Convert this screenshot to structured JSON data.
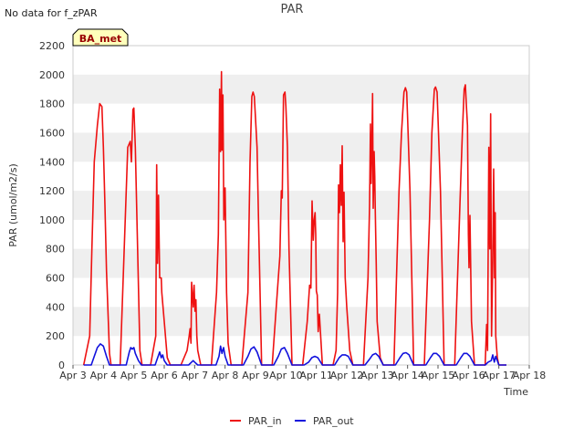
{
  "header": {
    "no_data_text": "No data for f_zPAR",
    "title": "PAR"
  },
  "site_badge": "BA_met",
  "colors": {
    "PAR_in": "#ee1111",
    "PAR_out": "#1111dd",
    "band": "#efefef",
    "badge_fill": "#ffffbb",
    "badge_text": "#990000"
  },
  "chart_data": {
    "type": "line",
    "title": "PAR",
    "xlabel": "Time",
    "ylabel": "PAR (umol/m2/s)",
    "ylim": [
      0,
      2200
    ],
    "xlim": [
      3,
      18
    ],
    "yticks": [
      0,
      200,
      400,
      600,
      800,
      1000,
      1200,
      1400,
      1600,
      1800,
      2000,
      2200
    ],
    "xticks": [
      3,
      4,
      5,
      6,
      7,
      8,
      9,
      10,
      11,
      12,
      13,
      14,
      15,
      16,
      17,
      18
    ],
    "xtick_labels": [
      "Apr 3",
      "Apr 4",
      "Apr 5",
      "Apr 6",
      "Apr 7",
      "Apr 8",
      "Apr 9",
      "Apr 10",
      "Apr 11",
      "Apr 12",
      "Apr 13",
      "Apr 14",
      "Apr 15",
      "Apr 16",
      "Apr 17",
      "Apr 18"
    ],
    "x_unit": "day of April",
    "grid": "horizontal bands",
    "legend_position": "bottom",
    "series": [
      {
        "name": "PAR_in",
        "x": [
          3.35,
          3.55,
          3.62,
          3.7,
          3.8,
          3.88,
          3.95,
          4.0,
          4.05,
          4.1,
          4.2,
          4.25,
          4.55,
          4.8,
          4.88,
          4.92,
          4.97,
          5.0,
          5.05,
          5.2,
          5.27,
          5.55,
          5.72,
          5.75,
          5.78,
          5.81,
          5.85,
          5.9,
          5.92,
          6.0,
          6.1,
          6.2,
          6.55,
          6.75,
          6.82,
          6.85,
          6.88,
          6.9,
          6.95,
          6.98,
          7.01,
          7.04,
          7.07,
          7.1,
          7.2,
          7.55,
          7.72,
          7.78,
          7.82,
          7.85,
          7.88,
          7.9,
          7.93,
          7.96,
          8.0,
          8.05,
          8.1,
          8.2,
          8.55,
          8.75,
          8.82,
          8.88,
          8.92,
          8.96,
          9.0,
          9.05,
          9.1,
          9.2,
          9.55,
          9.75,
          9.8,
          9.85,
          9.88,
          9.92,
          9.97,
          10.0,
          10.05,
          10.1,
          10.2,
          10.55,
          10.7,
          10.78,
          10.82,
          10.86,
          10.9,
          10.93,
          10.96,
          10.98,
          11.0,
          11.03,
          11.06,
          11.1,
          11.2,
          11.55,
          11.65,
          11.7,
          11.73,
          11.76,
          11.79,
          11.82,
          11.85,
          11.88,
          11.91,
          11.95,
          12.0,
          12.1,
          12.2,
          12.55,
          12.7,
          12.75,
          12.78,
          12.8,
          12.83,
          12.85,
          12.87,
          12.9,
          12.92,
          12.94,
          12.97,
          13.0,
          13.1,
          13.2,
          13.55,
          13.72,
          13.8,
          13.88,
          13.93,
          13.97,
          14.0,
          14.08,
          14.2,
          14.55,
          14.72,
          14.8,
          14.88,
          14.92,
          14.97,
          15.0,
          15.08,
          15.2,
          15.55,
          15.72,
          15.8,
          15.86,
          15.9,
          15.93,
          15.97,
          16.0,
          16.02,
          16.05,
          16.1,
          16.2,
          16.55,
          16.6,
          16.63,
          16.67,
          16.7,
          16.73,
          16.76,
          16.8,
          16.83,
          16.86,
          16.88,
          16.9,
          16.95,
          17.0
        ],
        "values": [
          0,
          200,
          800,
          1400,
          1650,
          1800,
          1780,
          1500,
          1100,
          650,
          80,
          0,
          0,
          1500,
          1540,
          1400,
          1760,
          1770,
          1500,
          100,
          0,
          0,
          200,
          1380,
          700,
          1170,
          600,
          600,
          500,
          300,
          50,
          0,
          0,
          100,
          200,
          250,
          150,
          570,
          400,
          550,
          370,
          450,
          200,
          100,
          0,
          0,
          500,
          900,
          1900,
          1470,
          2020,
          1480,
          1860,
          1000,
          1220,
          500,
          150,
          0,
          0,
          500,
          1400,
          1850,
          1880,
          1850,
          1700,
          1500,
          1000,
          0,
          0,
          600,
          750,
          1200,
          1150,
          1860,
          1880,
          1780,
          1500,
          800,
          0,
          0,
          300,
          550,
          530,
          1130,
          860,
          1000,
          1050,
          900,
          510,
          480,
          230,
          350,
          0,
          0,
          100,
          500,
          1240,
          1050,
          1380,
          1100,
          1510,
          850,
          1190,
          600,
          400,
          100,
          0,
          0,
          600,
          1100,
          1660,
          1250,
          1580,
          1870,
          1080,
          1470,
          1300,
          1050,
          700,
          300,
          50,
          0,
          0,
          1200,
          1600,
          1880,
          1910,
          1880,
          1700,
          1200,
          0,
          0,
          1000,
          1600,
          1900,
          1915,
          1880,
          1700,
          1200,
          0,
          0,
          1100,
          1600,
          1900,
          1930,
          1800,
          1650,
          900,
          670,
          1030,
          300,
          0,
          0,
          280,
          100,
          1500,
          800,
          1730,
          200,
          720,
          1350,
          600,
          1050,
          200,
          50,
          0
        ]
      },
      {
        "name": "PAR_out",
        "x": [
          3.6,
          3.7,
          3.8,
          3.9,
          4.0,
          4.1,
          4.2,
          4.75,
          4.85,
          4.9,
          4.95,
          5.0,
          5.05,
          5.15,
          5.25,
          5.7,
          5.8,
          5.85,
          5.9,
          5.95,
          6.0,
          6.1,
          6.8,
          6.9,
          6.95,
          7.0,
          7.1,
          7.7,
          7.8,
          7.85,
          7.9,
          7.95,
          8.0,
          8.1,
          8.6,
          8.75,
          8.85,
          8.95,
          9.05,
          9.2,
          9.6,
          9.75,
          9.85,
          9.95,
          10.05,
          10.2,
          10.6,
          10.75,
          10.85,
          10.95,
          11.05,
          11.2,
          11.6,
          11.75,
          11.85,
          11.95,
          12.05,
          12.2,
          12.6,
          12.75,
          12.85,
          12.95,
          13.05,
          13.2,
          13.6,
          13.75,
          13.85,
          13.95,
          14.05,
          14.2,
          14.6,
          14.75,
          14.85,
          14.95,
          15.05,
          15.2,
          15.6,
          15.75,
          15.85,
          15.95,
          16.05,
          16.2,
          16.55,
          16.65,
          16.75,
          16.8,
          16.85,
          16.9,
          16.95,
          17.0
        ],
        "values": [
          0,
          60,
          120,
          145,
          130,
          60,
          0,
          0,
          90,
          120,
          110,
          120,
          80,
          30,
          0,
          0,
          60,
          90,
          50,
          70,
          30,
          0,
          0,
          20,
          30,
          20,
          0,
          0,
          60,
          130,
          80,
          120,
          60,
          0,
          0,
          60,
          110,
          125,
          90,
          0,
          0,
          60,
          110,
          120,
          80,
          0,
          0,
          20,
          50,
          60,
          50,
          0,
          0,
          50,
          70,
          70,
          60,
          0,
          0,
          40,
          70,
          80,
          60,
          0,
          0,
          50,
          80,
          85,
          70,
          0,
          0,
          50,
          80,
          80,
          60,
          0,
          0,
          50,
          80,
          80,
          60,
          0,
          0,
          20,
          30,
          70,
          20,
          60,
          30,
          0
        ]
      }
    ]
  }
}
